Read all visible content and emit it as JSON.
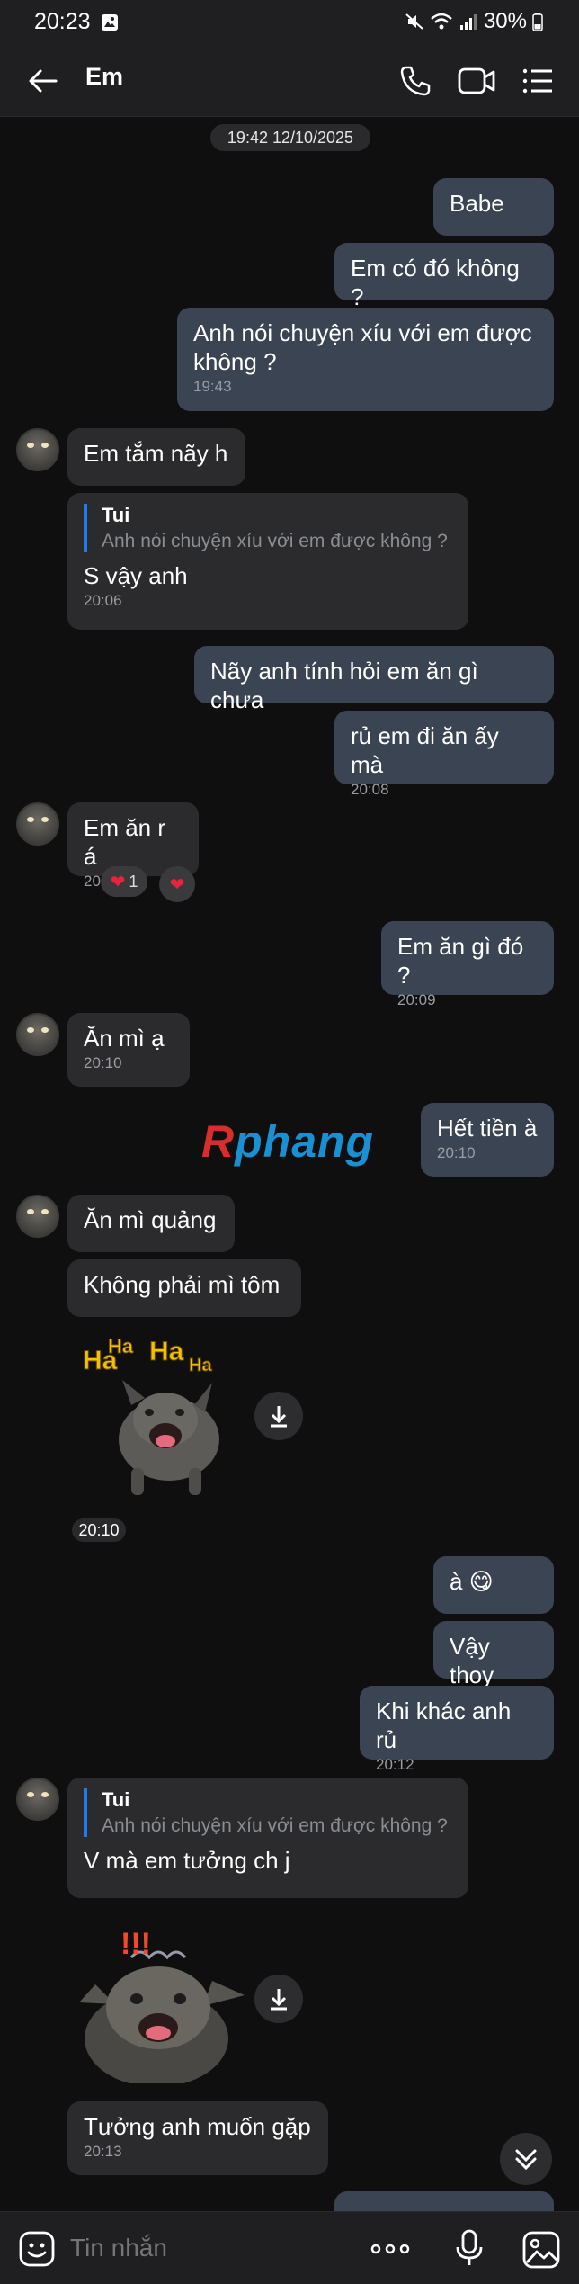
{
  "status": {
    "time": "20:23",
    "battery": "30%"
  },
  "header": {
    "title": "Em"
  },
  "date_chip": "19:42 12/10/2025",
  "messages": [
    {
      "dir": "out",
      "text": "Babe"
    },
    {
      "dir": "out",
      "text": "Em có đó không ?"
    },
    {
      "dir": "out",
      "text": "Anh nói chuyện xíu với em được không ?",
      "time": "19:43"
    },
    {
      "dir": "in",
      "text": "Em tắm nãy h"
    },
    {
      "dir": "in",
      "quote_name": "Tui",
      "quote_text": "Anh nói chuyện xíu với em được không ?",
      "text": "S vậy anh",
      "time": "20:06"
    },
    {
      "dir": "out",
      "text": "Nãy anh tính hỏi em ăn gì chưa"
    },
    {
      "dir": "out",
      "text": "rủ em đi ăn ấy mà",
      "time": "20:08"
    },
    {
      "dir": "in",
      "text": "Em ăn r á",
      "time": "20:09",
      "reaction_count": "1"
    },
    {
      "dir": "out",
      "text": "Em ăn gì đó ?",
      "time": "20:09"
    },
    {
      "dir": "in",
      "text": "Ăn mì ạ",
      "time": "20:10"
    },
    {
      "dir": "out",
      "text": "Hết tiền à",
      "time": "20:10"
    },
    {
      "dir": "in",
      "text": "Ăn mì quảng"
    },
    {
      "dir": "in",
      "text": "Không phải mì tôm"
    },
    {
      "dir": "in",
      "sticker": "laughing-dog-sticker",
      "sticker_text": "Ha Ha Ha Ha",
      "time": "20:10"
    },
    {
      "dir": "out",
      "text": "à 😋"
    },
    {
      "dir": "out",
      "text": "Vậy thoy"
    },
    {
      "dir": "out",
      "text": "Khi khác anh rủ",
      "time": "20:12"
    },
    {
      "dir": "in",
      "quote_name": "Tui",
      "quote_text": "Anh nói chuyện xíu với em được không ?",
      "text": "V mà em tưởng ch j"
    },
    {
      "dir": "in",
      "sticker": "shocked-dog-sticker",
      "sticker_text": "!!!"
    },
    {
      "dir": "in",
      "text": "Tưởng anh muốn gặp",
      "time": "20:13"
    }
  ],
  "watermark": {
    "r": "R",
    "rest": "phang"
  },
  "input": {
    "placeholder": "Tin nhắn"
  },
  "colors": {
    "outgoing_bubble": "#3b4452",
    "incoming_bubble": "#2b2b2d",
    "quote_bar": "#1e7cf0",
    "heart": "#e8243c"
  },
  "icons": [
    "back-icon",
    "call-icon",
    "video-call-icon",
    "menu-icon",
    "download-icon",
    "scroll-down-icon",
    "emoji-icon",
    "more-icon",
    "mic-icon",
    "image-icon"
  ]
}
